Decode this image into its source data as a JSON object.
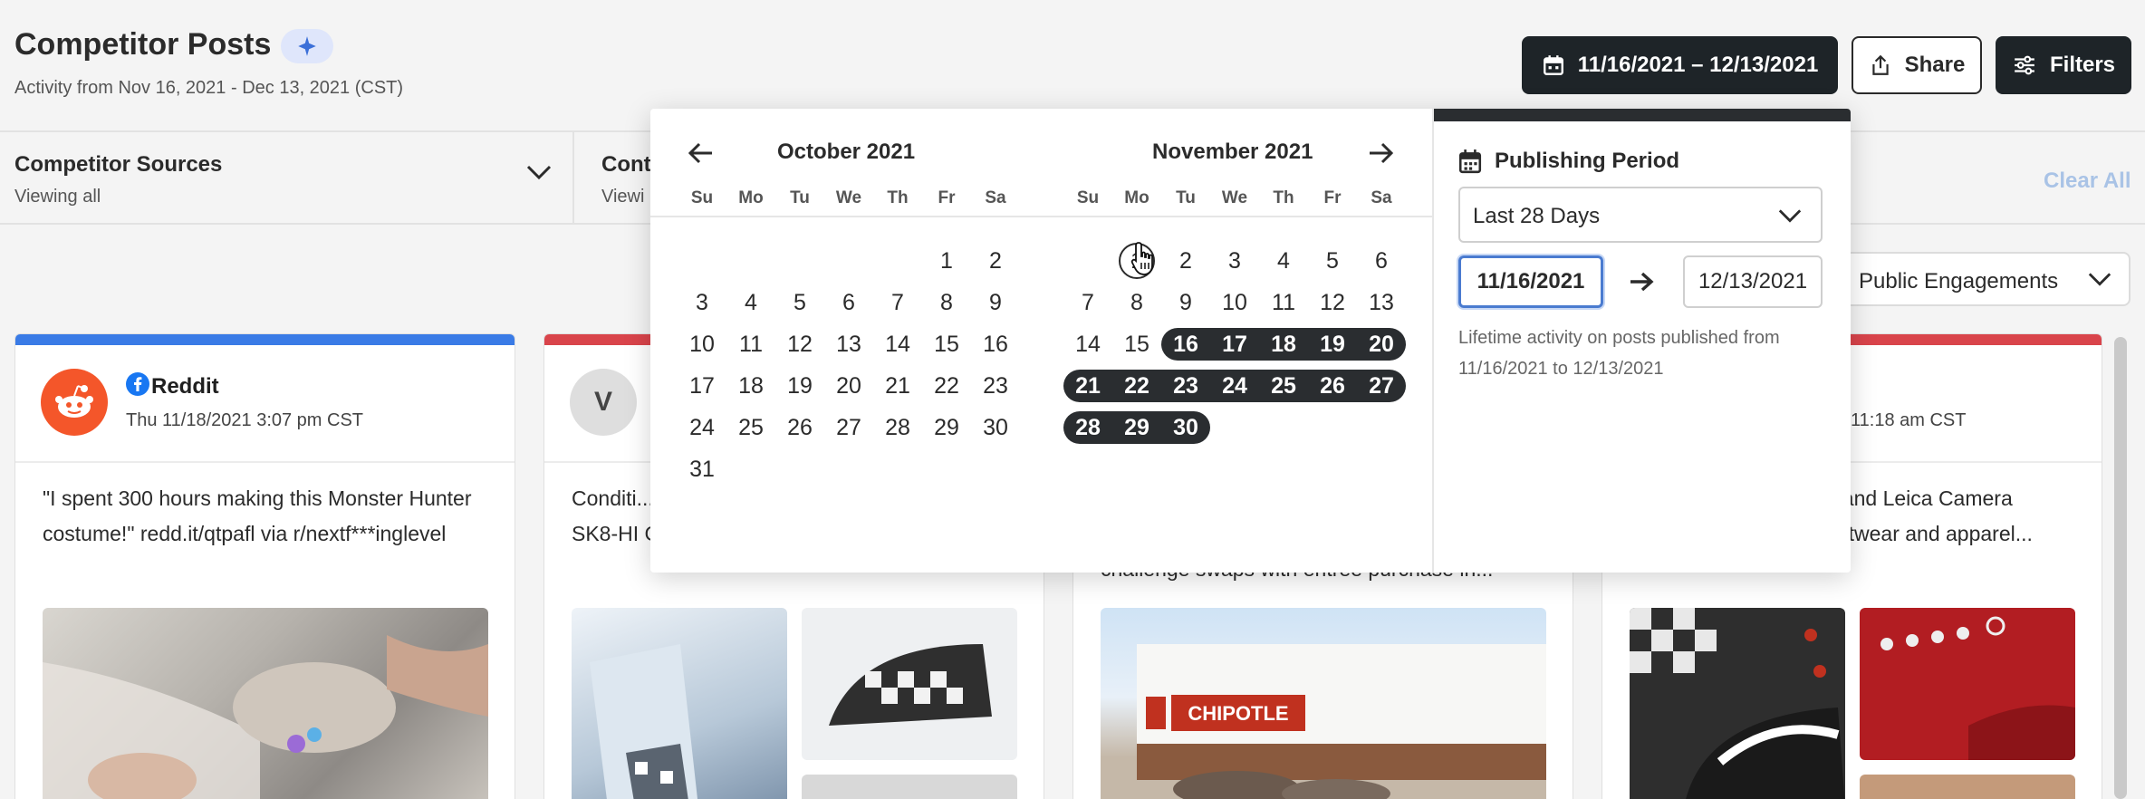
{
  "header": {
    "title": "Competitor Posts",
    "subtitle": "Activity from Nov 16, 2021 - Dec 13, 2021 (CST)",
    "date_range_label": "11/16/2021 – 12/13/2021",
    "share_label": "Share",
    "filters_label": "Filters"
  },
  "filterbar": {
    "sources_title": "Competitor Sources",
    "sources_sub": "Viewing all",
    "content_title": "Cont",
    "content_sub": "Viewi",
    "clear_all": "Clear All"
  },
  "sort": {
    "selected": "Public Engagements"
  },
  "cards": [
    {
      "platform": "Reddit",
      "date": "Thu 11/18/2021 3:07 pm CST",
      "text": "\"I spent 300 hours making this Monster Hunter costume!\" redd.it/qtpafl via r/nextf***inglevel",
      "bar_color": "#3a7be6"
    },
    {
      "avatar_letter": "V",
      "text": "Conditi... never a... advanced, purpose-built SK8-HI GORE-TEX...",
      "bar_color": "#d9444b"
    },
    {
      "text": "challenge swaps with entree purchase in...",
      "sign": "CHIPOTLE",
      "bar_color": "#d9444b"
    },
    {
      "date": "11:18 am CST",
      "text": "Vans partnered with ... and Leica Camera (leica_camera) on a footwear and apparel...",
      "bar_color": "#d9444b"
    }
  ],
  "calendar": {
    "left_month": "October 2021",
    "right_month": "November 2021",
    "weekdays": [
      "Su",
      "Mo",
      "Tu",
      "We",
      "Th",
      "Fr",
      "Sa"
    ],
    "october_days": [
      "1",
      "2",
      "3",
      "4",
      "5",
      "6",
      "7",
      "8",
      "9",
      "10",
      "11",
      "12",
      "13",
      "14",
      "15",
      "16",
      "17",
      "18",
      "19",
      "20",
      "21",
      "22",
      "23",
      "24",
      "25",
      "26",
      "27",
      "28",
      "29",
      "30",
      "31"
    ],
    "november_days": [
      "1",
      "2",
      "3",
      "4",
      "5",
      "6",
      "7",
      "8",
      "9",
      "10",
      "11",
      "12",
      "13",
      "14",
      "15",
      "16",
      "17",
      "18",
      "19",
      "20",
      "21",
      "22",
      "23",
      "24",
      "25",
      "26",
      "27",
      "28",
      "29",
      "30"
    ],
    "october_first_weekday": 5,
    "november_first_weekday": 1,
    "selected_range": [
      16,
      30
    ]
  },
  "publishing": {
    "label": "Publishing Period",
    "preset": "Last 28 Days",
    "start": "11/16/2021",
    "end": "12/13/2021",
    "lifetime_text": "Lifetime activity on posts published from 11/16/2021 to 12/13/2021"
  }
}
